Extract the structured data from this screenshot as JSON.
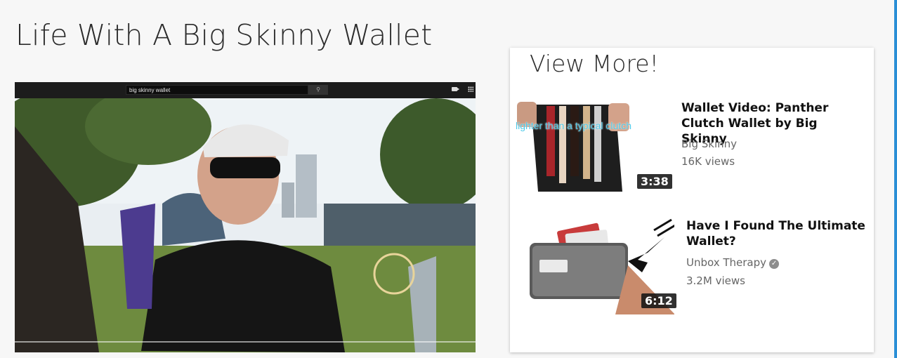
{
  "page": {
    "title": "Life With A Big Skinny Wallet"
  },
  "player": {
    "search_value": "big skinny wallet",
    "search_icon": "search-icon",
    "camera_icon": "video-camera-icon",
    "apps_icon": "apps-grid-icon"
  },
  "sidebar": {
    "heading": "View More!",
    "items": [
      {
        "title": "Wallet Video: Panther Clutch Wallet by Big Skinny",
        "channel": "Big Skinny",
        "views": "16K views",
        "duration": "3:38",
        "overlay_text": "lighter than a typical clutch"
      },
      {
        "title": "Have I Found The Ultimate Wallet?",
        "channel": "Unbox Therapy",
        "verified": true,
        "views": "3.2M views",
        "duration": "6:12"
      }
    ]
  },
  "colors": {
    "accent_edge": "#2a8fd6",
    "overlay_text": "#4fc9e8"
  }
}
